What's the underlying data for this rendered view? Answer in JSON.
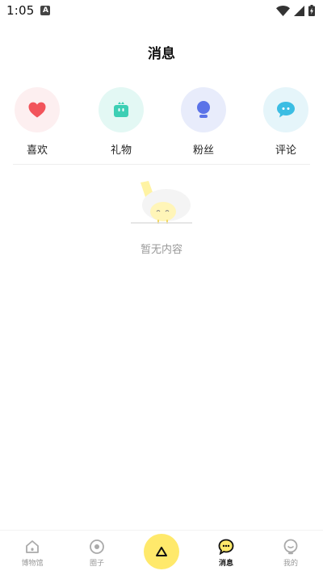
{
  "status_bar": {
    "time": "1:05",
    "notification_letter": "A",
    "icons": [
      "wifi-icon",
      "signal-icon",
      "battery-charging-icon"
    ]
  },
  "header": {
    "title": "消息"
  },
  "categories": [
    {
      "label": "喜欢",
      "icon": "heart-icon",
      "color": "#f2545b",
      "bg": "#fdeff0"
    },
    {
      "label": "礼物",
      "icon": "gift-icon",
      "color": "#3ccfb4",
      "bg": "#e3f8f4"
    },
    {
      "label": "粉丝",
      "icon": "fans-icon",
      "color": "#5b73e8",
      "bg": "#e8ecfb"
    },
    {
      "label": "评论",
      "icon": "comment-icon",
      "color": "#3bbde3",
      "bg": "#e5f5fa"
    }
  ],
  "empty_state": {
    "text": "暂无内容",
    "accent": "#fff3a3"
  },
  "tabbar": {
    "tabs": [
      {
        "label": "博物馆",
        "icon": "home-icon",
        "active": false
      },
      {
        "label": "圈子",
        "icon": "circle-icon",
        "active": false
      },
      {
        "label": "消息",
        "icon": "message-icon",
        "active": true
      },
      {
        "label": "我的",
        "icon": "profile-icon",
        "active": false
      }
    ],
    "center_button": {
      "icon": "triangle-icon",
      "color": "#ffe96b"
    }
  }
}
